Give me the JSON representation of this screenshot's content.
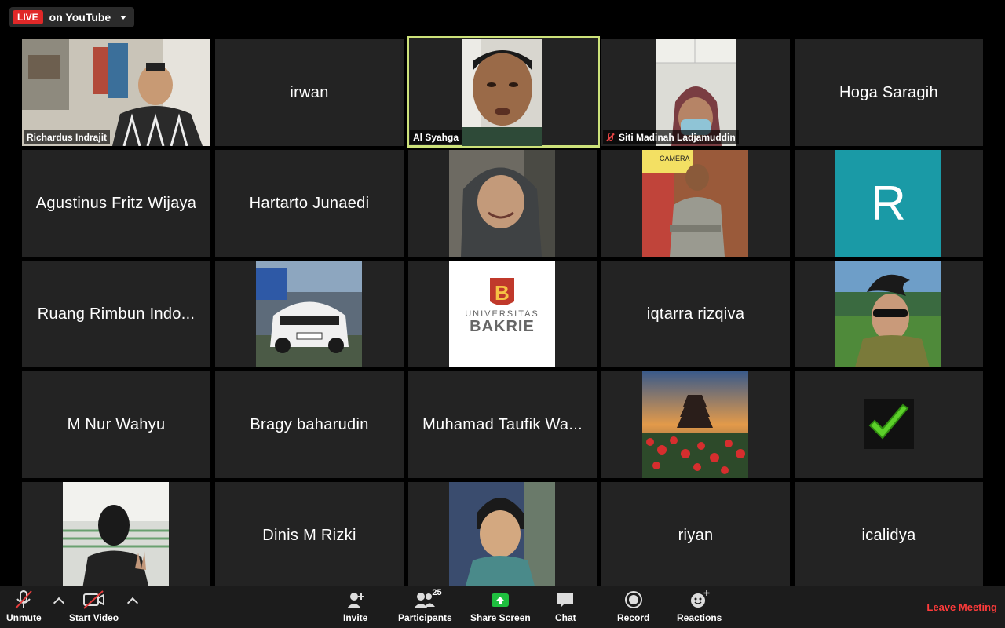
{
  "live": {
    "badge": "LIVE",
    "text": "on YouTube"
  },
  "tiles": [
    {
      "name": "Richardus Indrajit"
    },
    {
      "name": "irwan"
    },
    {
      "name": "Al Syahga"
    },
    {
      "name": "Siti Madinah Ladjamuddin"
    },
    {
      "name": "Hoga Saragih"
    },
    {
      "name": "Agustinus Fritz Wijaya"
    },
    {
      "name": "Hartarto Junaedi"
    },
    {
      "name": ""
    },
    {
      "name": ""
    },
    {
      "name": "",
      "avatar_letter": "R",
      "avatar_color": "#1a9aa6"
    },
    {
      "name": "Ruang Rimbun Indo..."
    },
    {
      "name": ""
    },
    {
      "name": "",
      "logo_line1": "UNIVERSITAS",
      "logo_line2": "BAKRIE",
      "logo_mark": "B"
    },
    {
      "name": "iqtarra rizqiva"
    },
    {
      "name": ""
    },
    {
      "name": "M Nur Wahyu"
    },
    {
      "name": "Bragy baharudin"
    },
    {
      "name": "Muhamad Taufik Wa..."
    },
    {
      "name": ""
    },
    {
      "name": ""
    },
    {
      "name": ""
    },
    {
      "name": "Dinis M Rizki"
    },
    {
      "name": ""
    },
    {
      "name": "riyan"
    },
    {
      "name": "icalidya"
    }
  ],
  "toolbar": {
    "unmute": "Unmute",
    "start_video": "Start Video",
    "invite": "Invite",
    "participants": "Participants",
    "participants_count": "25",
    "share_screen": "Share Screen",
    "chat": "Chat",
    "record": "Record",
    "reactions": "Reactions",
    "leave": "Leave Meeting"
  },
  "colors": {
    "active_speaker": "#cde27a",
    "share_green": "#1fbf3f",
    "leave_red": "#ff3b3b"
  }
}
